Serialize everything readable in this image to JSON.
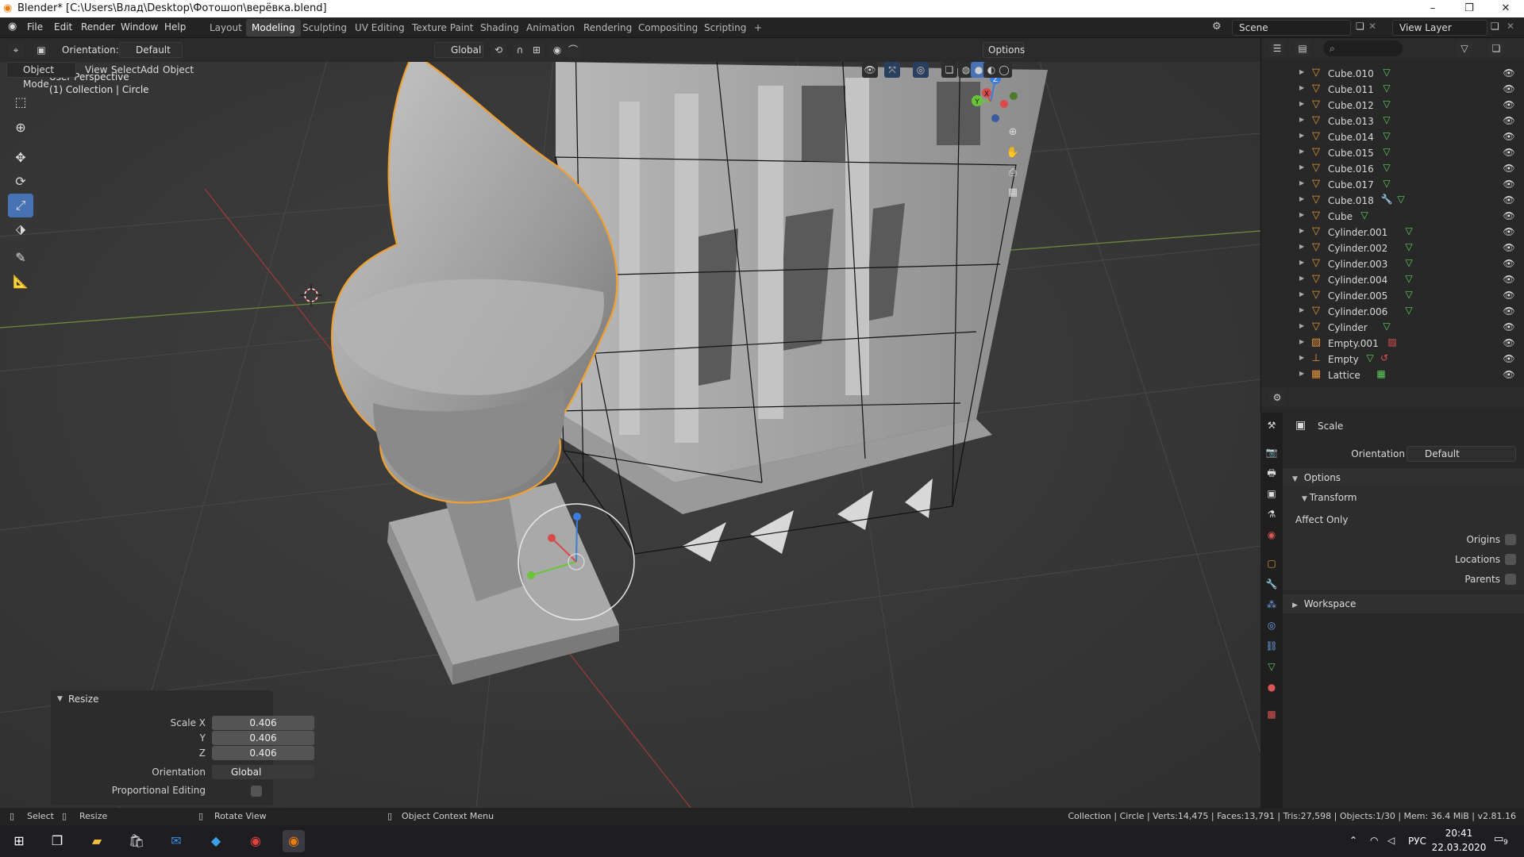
{
  "window": {
    "title": "Blender* [C:\\Users\\Влад\\Desktop\\Фотошоп\\верёвка.blend]",
    "controls": [
      "–",
      "❐",
      "✕"
    ]
  },
  "menu": {
    "items": [
      "File",
      "Edit",
      "Render",
      "Window",
      "Help"
    ]
  },
  "workspaces": {
    "tabs": [
      "Layout",
      "Modeling",
      "Sculpting",
      "UV Editing",
      "Texture Paint",
      "Shading",
      "Animation",
      "Rendering",
      "Compositing",
      "Scripting",
      "+"
    ],
    "active": "Modeling"
  },
  "scene": {
    "name": "Scene",
    "view_layer": "View Layer"
  },
  "tool_header": {
    "orientation_label": "Orientation:",
    "orientation_value": "Default",
    "transform_orientation": "Global",
    "options_label": "Options"
  },
  "view_header": {
    "mode": "Object Mode",
    "menus": [
      "View",
      "Select",
      "Add",
      "Object"
    ]
  },
  "viewport": {
    "perspective": "User Perspective",
    "collection_info": "(1) Collection | Circle",
    "gizmo_axes": [
      "Z",
      "Y",
      "X"
    ]
  },
  "redo_panel": {
    "title": "Resize",
    "scale_x_label": "Scale X",
    "scale_y_label": "Y",
    "scale_z_label": "Z",
    "scale_x": "0.406",
    "scale_y": "0.406",
    "scale_z": "0.406",
    "orientation_label": "Orientation",
    "orientation_value": "Global",
    "proportional_label": "Proportional Editing"
  },
  "outliner": {
    "items": [
      {
        "name": "Cube.010",
        "data": "mesh"
      },
      {
        "name": "Cube.011",
        "data": "mesh"
      },
      {
        "name": "Cube.012",
        "data": "mesh"
      },
      {
        "name": "Cube.013",
        "data": "mesh"
      },
      {
        "name": "Cube.014",
        "data": "mesh"
      },
      {
        "name": "Cube.015",
        "data": "mesh"
      },
      {
        "name": "Cube.016",
        "data": "mesh"
      },
      {
        "name": "Cube.017",
        "data": "mesh"
      },
      {
        "name": "Cube.018",
        "data": "modifier+mesh"
      },
      {
        "name": "Cube",
        "data": "mesh"
      },
      {
        "name": "Cylinder.001",
        "data": "mesh"
      },
      {
        "name": "Cylinder.002",
        "data": "mesh"
      },
      {
        "name": "Cylinder.003",
        "data": "mesh"
      },
      {
        "name": "Cylinder.004",
        "data": "mesh"
      },
      {
        "name": "Cylinder.005",
        "data": "mesh"
      },
      {
        "name": "Cylinder.006",
        "data": "mesh"
      },
      {
        "name": "Cylinder",
        "data": "mesh"
      },
      {
        "name": "Empty.001",
        "data": "image"
      },
      {
        "name": "Empty",
        "data": "constraint"
      },
      {
        "name": "Lattice",
        "data": "lattice"
      }
    ]
  },
  "properties": {
    "tool_name": "Scale",
    "orientation_label": "Orientation",
    "orientation_value": "Default",
    "options_label": "Options",
    "transform_label": "Transform",
    "affect_only_label": "Affect Only",
    "origins_label": "Origins",
    "locations_label": "Locations",
    "parents_label": "Parents",
    "workspace_label": "Workspace"
  },
  "statusbar": {
    "select": "Select",
    "resize": "Resize",
    "rotate_view": "Rotate View",
    "context_menu": "Object Context Menu",
    "stats": "Collection | Circle | Verts:14,475 | Faces:13,791 | Tris:27,598 | Objects:1/30 | Mem: 36.4 MiB | v2.81.16"
  },
  "taskbar": {
    "lang": "РУС",
    "time": "20:41",
    "date": "22.03.2020",
    "notifications": "9"
  },
  "colors": {
    "accent": "#4772b3",
    "selection_outline": "#f0a030",
    "mesh_data": "#5ad15a",
    "object_icon": "#e4943a"
  }
}
